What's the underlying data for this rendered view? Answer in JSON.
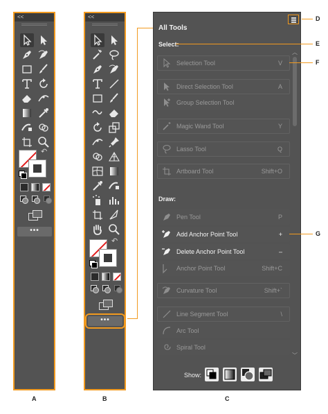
{
  "toolbar_a": {
    "collapse_glyph": "<<",
    "more_label": "•••",
    "label": "A"
  },
  "toolbar_b": {
    "collapse_glyph": "<<",
    "more_label": "•••",
    "label": "B"
  },
  "panel": {
    "title": "All Tools",
    "label": "C",
    "select_section": {
      "title": "Select:",
      "tools": [
        {
          "name": "Selection Tool",
          "shortcut": "V",
          "icon": "selection-arrow-icon"
        },
        {
          "name": "Direct Selection Tool",
          "shortcut": "A",
          "icon": "direct-selection-icon"
        },
        {
          "name": "Group Selection Tool",
          "shortcut": "",
          "icon": "group-selection-icon"
        },
        {
          "name": "Magic Wand Tool",
          "shortcut": "Y",
          "icon": "magic-wand-icon"
        },
        {
          "name": "Lasso Tool",
          "shortcut": "Q",
          "icon": "lasso-icon"
        },
        {
          "name": "Artboard Tool",
          "shortcut": "Shift+O",
          "icon": "artboard-icon"
        }
      ]
    },
    "draw_section": {
      "title": "Draw:",
      "tools": [
        {
          "name": "Pen Tool",
          "shortcut": "P",
          "icon": "pen-icon"
        },
        {
          "name": "Add Anchor Point Tool",
          "shortcut": "+",
          "icon": "add-anchor-point-icon"
        },
        {
          "name": "Delete Anchor Point Tool",
          "shortcut": "–",
          "icon": "delete-anchor-point-icon"
        },
        {
          "name": "Anchor Point Tool",
          "shortcut": "Shift+C",
          "icon": "anchor-point-icon"
        },
        {
          "name": "Curvature Tool",
          "shortcut": "Shift+`",
          "icon": "curvature-icon"
        },
        {
          "name": "Line Segment Tool",
          "shortcut": "\\",
          "icon": "line-segment-icon"
        },
        {
          "name": "Arc Tool",
          "shortcut": "",
          "icon": "arc-icon"
        },
        {
          "name": "Spiral Tool",
          "shortcut": "",
          "icon": "spiral-icon"
        }
      ]
    },
    "show_label": "Show:"
  },
  "callouts": {
    "d": "D",
    "e": "E",
    "f": "F",
    "g": "G"
  },
  "colors": {
    "toolbar_bg": "#535353",
    "highlight": "#f29a1f",
    "none_red": "#e21b1b"
  }
}
